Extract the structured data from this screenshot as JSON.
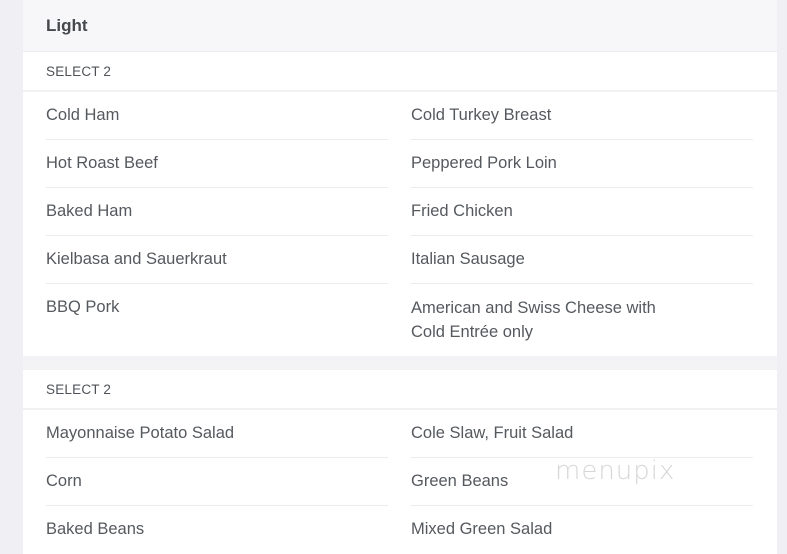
{
  "section": {
    "title": "Light",
    "groups": [
      {
        "label": "SELECT 2",
        "left": [
          "Cold Ham",
          "Hot Roast Beef",
          "Baked Ham",
          "Kielbasa and Sauerkraut",
          "BBQ Pork"
        ],
        "right": [
          "Cold Turkey Breast",
          "Peppered Pork Loin",
          "Fried Chicken",
          "Italian Sausage",
          "American and Swiss Cheese with Cold Entrée only"
        ]
      },
      {
        "label": "SELECT 2",
        "left": [
          "Mayonnaise Potato Salad",
          "Corn",
          "Baked Beans"
        ],
        "right": [
          "Cole Slaw, Fruit Salad",
          "Green Beans",
          "Mixed Green Salad"
        ]
      }
    ]
  },
  "watermark": "menupix"
}
